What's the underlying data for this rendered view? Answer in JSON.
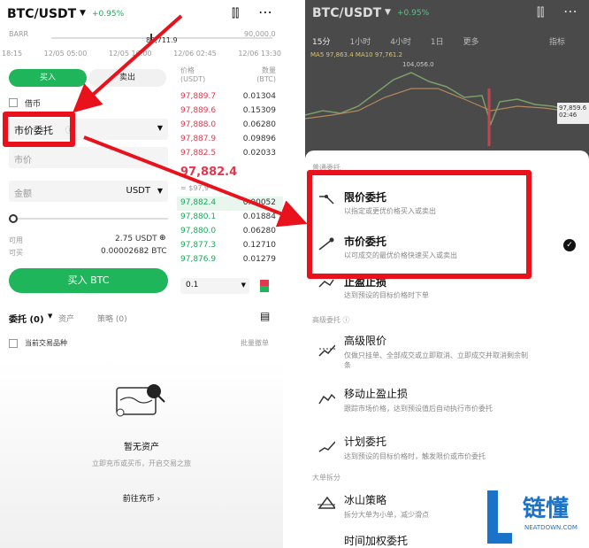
{
  "left": {
    "pair": "BTC/USDT",
    "change": "+0.95%",
    "bar_label": "BARR",
    "bar_value_mid": "89,711.9",
    "bar_value_right": "90,000.0",
    "times": [
      "18:15",
      "12/05 05:00",
      "12/05 16:00",
      "12/06 02:45",
      "12/06 13:30"
    ],
    "tab_buy": "买入",
    "tab_sell": "卖出",
    "margin_label": "借币",
    "order_type": "市价委托",
    "price_placeholder": "市价",
    "amount_placeholder": "金额",
    "amount_unit": "USDT",
    "available_label": "可用",
    "available_value": "2.75 USDT",
    "canbuy_label": "可买",
    "canbuy_value": "0.00002682 BTC",
    "buy_button": "买入 BTC",
    "ob_header_price": "价格\n(USDT)",
    "ob_header_qty": "数量\n(BTC)",
    "asks": [
      {
        "p": "97,889.7",
        "q": "0.01304"
      },
      {
        "p": "97,889.6",
        "q": "0.15309"
      },
      {
        "p": "97,888.0",
        "q": "0.06280"
      },
      {
        "p": "97,887.9",
        "q": "0.09896"
      },
      {
        "p": "97,882.5",
        "q": "0.02033"
      }
    ],
    "last_price": "97,882.4",
    "last_price_usd": "≈ $97,9",
    "bids": [
      {
        "p": "97,882.4",
        "q": "0.00052"
      },
      {
        "p": "97,880.1",
        "q": "0.01884"
      },
      {
        "p": "97,880.0",
        "q": "0.06280"
      },
      {
        "p": "97,877.3",
        "q": "0.12710"
      },
      {
        "p": "97,876.9",
        "q": "0.01279"
      }
    ],
    "depth_value": "0.1",
    "tab_orders": "委托 (0)",
    "tab_assets": "资产",
    "tab_strategy": "策略 (0)",
    "current_only": "当前交易品种",
    "batch_cancel": "批量撤单",
    "empty_title": "暂无资产",
    "empty_desc": "立即充币或买币，开启交易之旅",
    "empty_link": "前往充币"
  },
  "right": {
    "pair": "BTC/USDT",
    "change": "+0.95%",
    "intervals": [
      "15分",
      "1小时",
      "4小时",
      "1日",
      "更多"
    ],
    "indicator_tab": "指标",
    "ma_line": "MA5 97,863.4  MA10 97,761.2",
    "price_tag": "97,859.6\n02:46",
    "chart_price": "104,056.0",
    "section_header": "普通委托",
    "options": [
      {
        "title": "限价委托",
        "desc": "以指定或更优价格买入或卖出"
      },
      {
        "title": "市价委托",
        "desc": "以可成交的最优价格快速买入或卖出"
      },
      {
        "title": "止盈止损",
        "desc": "达到预设的目标价格时下单"
      }
    ],
    "advanced_header": "高级委托",
    "advanced": [
      {
        "title": "高级限价",
        "desc": "仅做只挂单、全部成交或立即取消、立即成交并取消剩余制条"
      },
      {
        "title": "移动止盈止损",
        "desc": "跟踪市场价格，达到预设值后自动执行市价委托"
      },
      {
        "title": "计划委托",
        "desc": "达到预设的目标价格时，触发限价或市价委托"
      }
    ],
    "split_header": "大单拆分",
    "split": [
      {
        "title": "冰山策略",
        "desc": "拆分大单为小单，减少滑点"
      },
      {
        "title": "时间加权委托",
        "desc": ""
      }
    ]
  },
  "watermark": {
    "text": "链懂",
    "sub": "NEATDOWN.COM"
  },
  "colors": {
    "green": "#1fb55a",
    "red": "#e0394e",
    "highlight": "#e8111c"
  }
}
